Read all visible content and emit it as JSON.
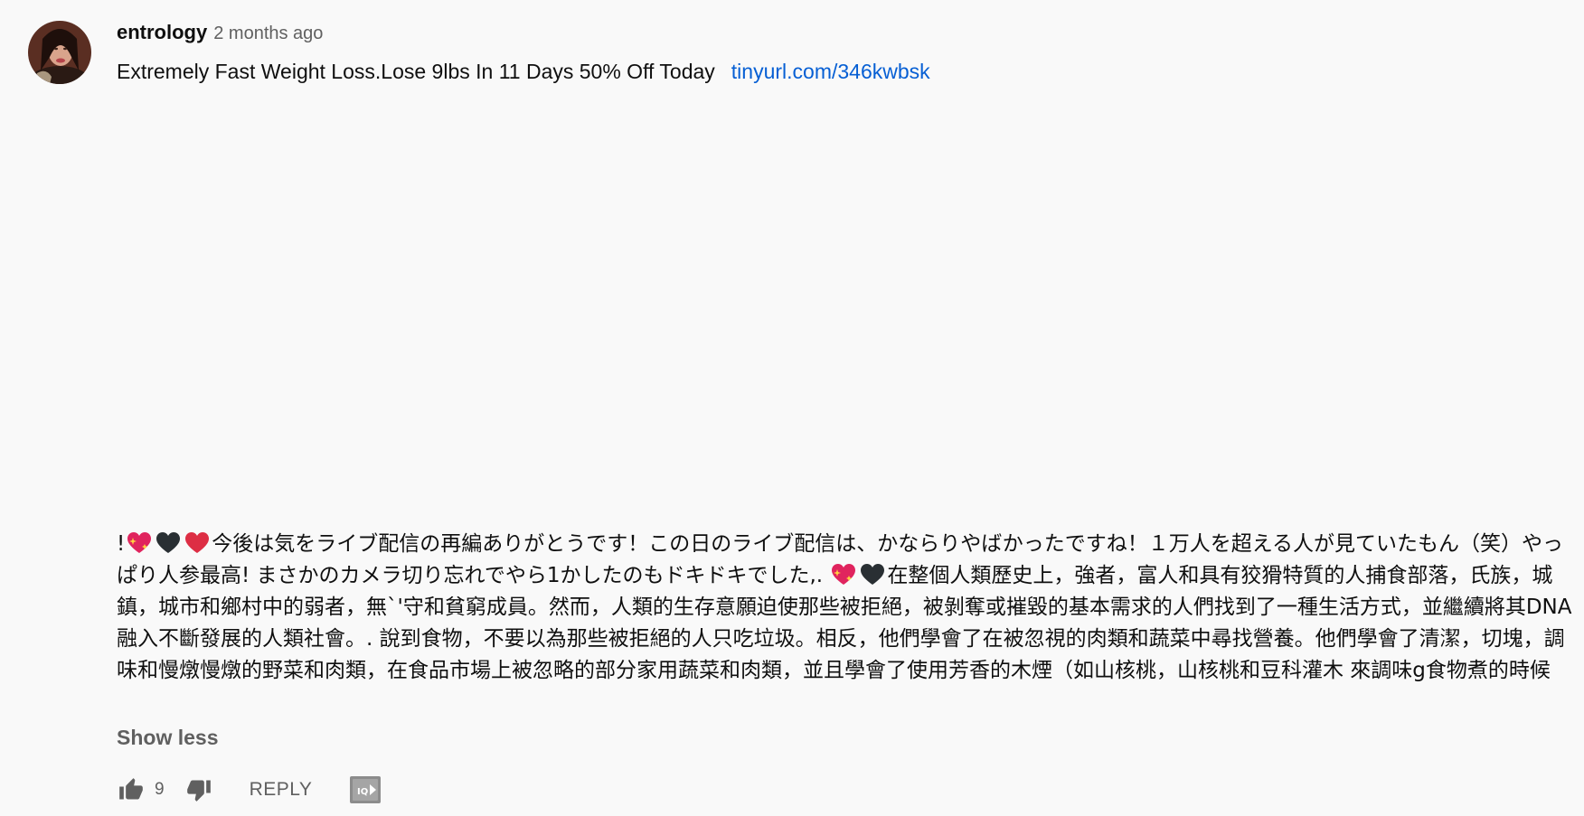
{
  "comment": {
    "author": "entrology",
    "time": "2 months ago",
    "text_first": "Extremely Fast Weight Loss.Lose 9lbs In 11 Days 50% Off Today",
    "link": "tinyurl.com/346kwbsk",
    "text_long_1": "!",
    "text_long_2": "今後は気をライブ配信の再編ありがとうです！この日のライブ配信は、かならりやばかったですね！１万人を超える人が見ていたもん（笑）やっぱり人参最高!  まさかのカメラ切り忘れでやら1かしたのもドキドキでした,. ",
    "text_long_3": "在整個人類歷史上，強者，富人和具有狡猾特質的人捕食部落，氏族，城鎮，城市和鄉村中的弱者，無`'守和貧窮成員。然而，人類的生存意願迫使那些被拒絕，被剝奪或摧毀的基本需求的人們找到了一種生活方式，並繼續將其DNA融入不斷發展的人類社會。. 說到食物，不要以為那些被拒絕的人只吃垃圾。相反，他們學會了在被忽視的肉類和蔬菜中尋找營養。他們學會了清潔，切塊，調味和慢燉慢燉的野菜和肉類，在食品市場上被忽略的部分家用蔬菜和肉類，並且學會了使用芳香的木煙（如山核桃，山核桃和豆科灌木 來調味g食物煮的時候",
    "show_less": "Show less",
    "like_count": "9",
    "reply": "REPLY"
  },
  "icons": {
    "like": "thumbs-up-icon",
    "dislike": "thumbs-down-icon",
    "extension": "iq-extension-icon",
    "heart_sparkle": "sparkling-heart-emoji",
    "heart_black": "black-heart-emoji",
    "heart_red": "red-heart-emoji"
  },
  "colors": {
    "link": "#065fd4",
    "secondary": "#606060",
    "background": "#f9f9f9"
  }
}
